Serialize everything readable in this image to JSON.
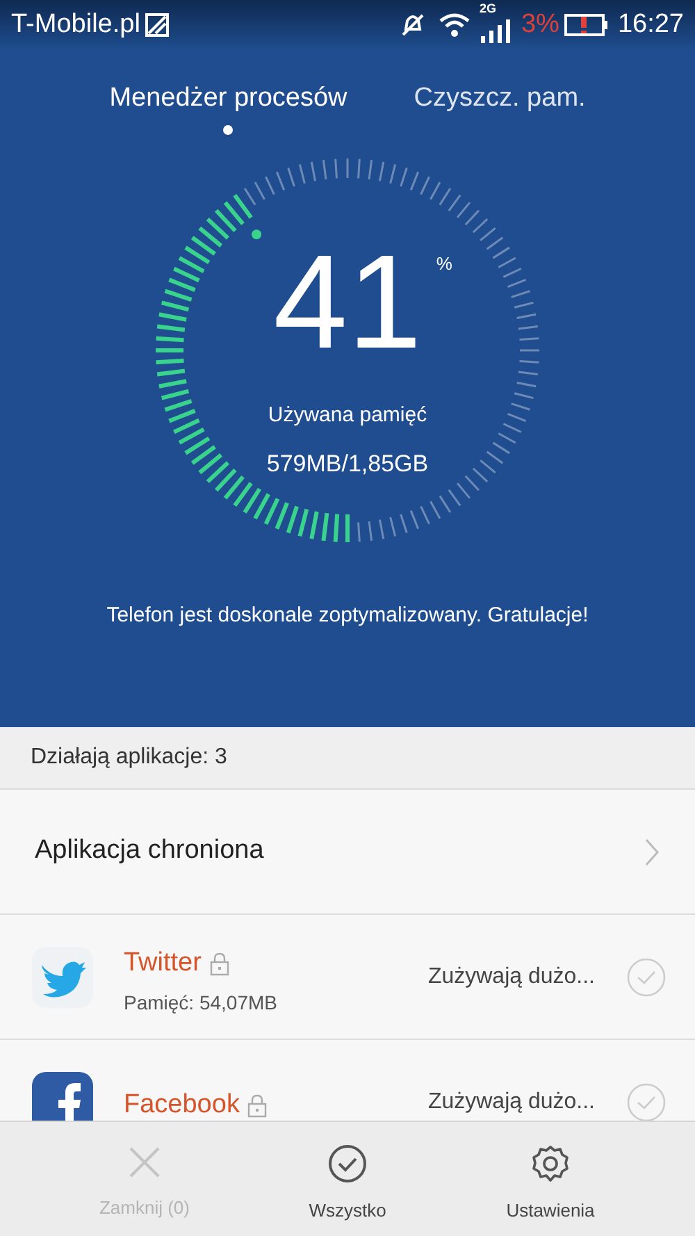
{
  "status_bar": {
    "carrier": "T-Mobile.pl",
    "network": "2G",
    "battery": "3%",
    "time": "16:27"
  },
  "tabs": [
    {
      "label": "Menedżer procesów",
      "selected": true
    },
    {
      "label": "Czyszcz. pam.",
      "selected": false
    }
  ],
  "gauge": {
    "value": "41",
    "unit": "%",
    "label": "Używana pamięć",
    "reading": "579MB/1,85GB"
  },
  "message": "Telefon jest doskonale zoptymalizowany. Gratulacje!",
  "running_header": "Działają aplikacje: 3",
  "protected_row": {
    "label": "Aplikacja chroniona"
  },
  "apps": [
    {
      "kind": "twitter",
      "name": "Twitter",
      "locked": true,
      "memory": "Pamięć: 54,07MB",
      "status": "Zużywają dużo...",
      "checked": false
    },
    {
      "kind": "facebook",
      "name": "Facebook",
      "locked": true,
      "status": "Zużywają dużo...",
      "checked": false
    }
  ],
  "bottom_bar": [
    {
      "kind": "close",
      "label": "Zamknij (0)",
      "disabled": true
    },
    {
      "kind": "all",
      "label": "Wszystko",
      "disabled": false
    },
    {
      "kind": "settings",
      "label": "Ustawienia",
      "disabled": false
    }
  ]
}
